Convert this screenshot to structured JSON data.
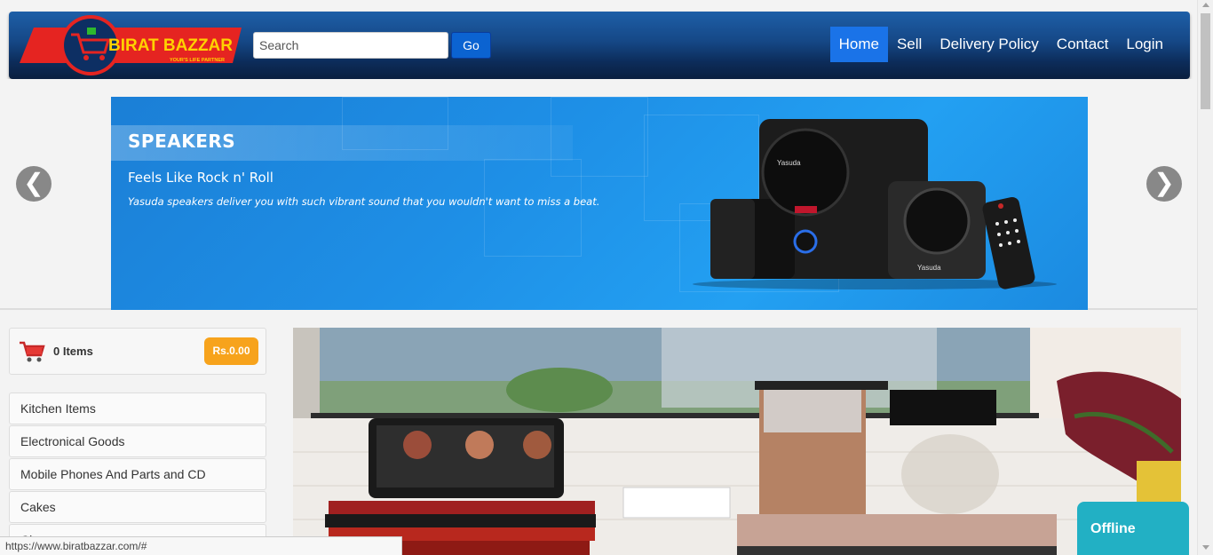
{
  "header": {
    "brand_name": "BIRAT BAZZAR",
    "brand_tagline": "YOUR'S LIFE PARTNER",
    "search_placeholder": "Search",
    "search_value": "",
    "go_label": "Go",
    "nav": [
      {
        "label": "Home",
        "active": true
      },
      {
        "label": "Sell",
        "active": false
      },
      {
        "label": "Delivery Policy",
        "active": false
      },
      {
        "label": "Contact",
        "active": false
      },
      {
        "label": "Login",
        "active": false
      }
    ]
  },
  "carousel": {
    "title": "SPEAKERS",
    "subtitle": "Feels Like Rock n' Roll",
    "description": "Yasuda speakers deliver you with such vibrant sound that you wouldn't want to miss a beat.",
    "brand_on_product": "Yasuda",
    "prev_glyph": "❮",
    "next_glyph": "❯"
  },
  "cart": {
    "items_label": "0 Items",
    "total": "Rs.0.00"
  },
  "categories": [
    "Kitchen Items",
    "Electronical Goods",
    "Mobile Phones And Parts and CD",
    "Cakes",
    "Cl..."
  ],
  "chat": {
    "status": "Offline"
  },
  "status_bar": {
    "url": "https://www.biratbazzar.com/#"
  },
  "colors": {
    "nav_active": "#1a73e8",
    "go_button": "#0b63d1",
    "cart_total": "#f7a31c",
    "offline": "#22b0c4",
    "banner": "#1e8fe6"
  }
}
